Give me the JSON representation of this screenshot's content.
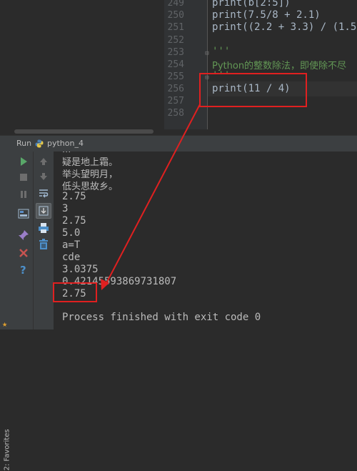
{
  "editor": {
    "lines": [
      {
        "no": "249",
        "code": "print(b[2:5])"
      },
      {
        "no": "250",
        "code": "print(7.5/8 + 2.1)"
      },
      {
        "no": "251",
        "code": "print((2.2 + 3.3) / (1.5"
      },
      {
        "no": "252",
        "code": ""
      },
      {
        "no": "253",
        "code": "'''"
      },
      {
        "no": "254",
        "code": "Python的整数除法，即使除不尽"
      },
      {
        "no": "255",
        "code": "'''"
      },
      {
        "no": "256",
        "code": "print(11 / 4)"
      },
      {
        "no": "257",
        "code": ""
      },
      {
        "no": "258",
        "code": ""
      }
    ]
  },
  "run_panel": {
    "label": "Run",
    "config_name": "python_4",
    "config_icon": "python-icon"
  },
  "favorites_label": "2: Favorites",
  "console": {
    "lines": [
      "疑是地上霜。",
      "举头望明月，",
      "低头思故乡。",
      "2.75",
      "3",
      "2.75",
      "5.0",
      "a=T",
      "cde",
      "3.0375",
      "0.42145593869731807",
      "2.75",
      "",
      "Process finished with exit code 0"
    ]
  },
  "colors": {
    "annotation": "#e02020",
    "background": "#2b2b2b",
    "panel": "#3c3f41"
  }
}
